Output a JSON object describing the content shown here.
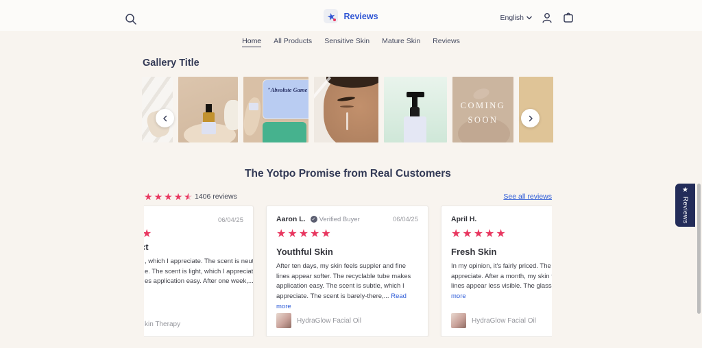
{
  "header": {
    "logo": {
      "text": "Reviews",
      "brand_color": "#2f55d4"
    },
    "language": {
      "label": "English"
    },
    "nav": [
      {
        "label": "Home",
        "active": true
      },
      {
        "label": "All Products",
        "active": false
      },
      {
        "label": "Sensitive Skin",
        "active": false
      },
      {
        "label": "Mature Skin",
        "active": false
      },
      {
        "label": "Reviews",
        "active": false
      }
    ]
  },
  "gallery": {
    "title": "Gallery Title",
    "tiles": [
      {
        "name": "gift-box-photo"
      },
      {
        "name": "dropper-bottle-in-hand-photo"
      },
      {
        "name": "quote-collage",
        "quote": "\"Absolute Game Changer\""
      },
      {
        "name": "face-serum-photo"
      },
      {
        "name": "pump-bottle-photo"
      },
      {
        "name": "coming-soon-tile",
        "label": "COMING SOON"
      },
      {
        "name": "gua-sha-hands-photo"
      }
    ]
  },
  "reviews_section": {
    "heading": "The Yotpo Promise from Real Customers",
    "accent_color": "#e8365f",
    "summary": {
      "rating": 4.5,
      "count_label": "1406 reviews",
      "see_all": "See all reviews"
    },
    "floating_tab": {
      "label": "Reviews"
    },
    "cards": [
      {
        "partial": true,
        "date": "06/04/25",
        "star_fragment": "★",
        "title_fragment": "ct",
        "lines": [
          ", which I appreciate. The scent is neutral,",
          "e. The scent is light, which I appreciate. The",
          "es application easy. After one week,..."
        ],
        "product_fragment": "kin Therapy"
      },
      {
        "author": "Aaron L.",
        "verified_label": "Verified Buyer",
        "date": "06/04/25",
        "stars": 5,
        "title": "Youthful Skin",
        "body": "After ten days, my skin feels suppler and fine lines appear softer. The recyclable tube makes application easy. The scent is subtle, which I appreciate. The scent is barely-there,... ",
        "read_more": "Read more",
        "product": "HydraGlow Facial Oil"
      },
      {
        "author": "April H.",
        "stars": 5,
        "title": "Fresh Skin",
        "lines": [
          "In my opinion, it's fairly priced. The scent is s",
          "appreciate. After a month, my skin feels smo",
          "lines appear less visible. The glass dropper"
        ],
        "read_more": "more",
        "product": "HydraGlow Facial Oil"
      }
    ]
  }
}
